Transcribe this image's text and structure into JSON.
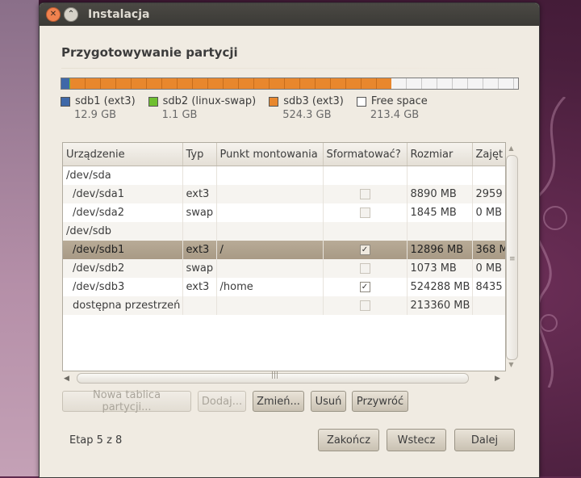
{
  "window": {
    "title": "Instalacja"
  },
  "page": {
    "heading": "Przygotowywanie partycji",
    "step": "Etap 5 z 8"
  },
  "partition_bar": [
    {
      "name": "sdb1",
      "fraction": 0.018,
      "color": "#3f68a8"
    },
    {
      "name": "sdb2",
      "fraction": 0.0015,
      "color": "#6fbf30"
    },
    {
      "name": "sdb3",
      "fraction": 0.7032,
      "color": "#e8872d"
    },
    {
      "name": "free",
      "fraction": 0.2773,
      "color": "#f4f4f4"
    }
  ],
  "legend": [
    {
      "label": "sdb1 (ext3)",
      "size": "12.9 GB",
      "color": "#3f68a8"
    },
    {
      "label": "sdb2 (linux-swap)",
      "size": "1.1 GB",
      "color": "#6fbf30"
    },
    {
      "label": "sdb3 (ext3)",
      "size": "524.3 GB",
      "color": "#e8872d"
    },
    {
      "label": "Free space",
      "size": "213.4 GB",
      "color": "#ffffff"
    }
  ],
  "table": {
    "headers": [
      "Urządzenie",
      "Typ",
      "Punkt montowania",
      "Sformatować?",
      "Rozmiar",
      "Zajęt"
    ],
    "rows": [
      {
        "device": "/dev/sda",
        "type": "",
        "mount": "",
        "format": null,
        "size": "",
        "used": "",
        "indent": false,
        "selected": false
      },
      {
        "device": "/dev/sda1",
        "type": "ext3",
        "mount": "",
        "format": false,
        "size": "8890 MB",
        "used": "2959",
        "indent": true,
        "selected": false
      },
      {
        "device": "/dev/sda2",
        "type": "swap",
        "mount": "",
        "format": false,
        "size": "1845 MB",
        "used": "0 MB",
        "indent": true,
        "selected": false
      },
      {
        "device": "/dev/sdb",
        "type": "",
        "mount": "",
        "format": null,
        "size": "",
        "used": "",
        "indent": false,
        "selected": false
      },
      {
        "device": "/dev/sdb1",
        "type": "ext3",
        "mount": "/",
        "format": true,
        "size": "12896 MB",
        "used": "368 M",
        "indent": true,
        "selected": true
      },
      {
        "device": "/dev/sdb2",
        "type": "swap",
        "mount": "",
        "format": false,
        "size": "1073 MB",
        "used": "0 MB",
        "indent": true,
        "selected": false
      },
      {
        "device": "/dev/sdb3",
        "type": "ext3",
        "mount": "/home",
        "format": true,
        "size": "524288 MB",
        "used": "8435",
        "indent": true,
        "selected": false
      },
      {
        "device": "dostępna przestrzeń",
        "type": "",
        "mount": "",
        "format": false,
        "size": "213360 MB",
        "used": "",
        "indent": true,
        "selected": false
      }
    ]
  },
  "buttons": {
    "new_table": "Nowa tablica partycji...",
    "add": "Dodaj...",
    "change": "Zmień...",
    "delete": "Usuń",
    "revert": "Przywróć",
    "quit": "Zakończ",
    "back": "Wstecz",
    "next": "Dalej"
  },
  "icons": {
    "close": "close-icon",
    "minimize": "minimize-icon"
  }
}
